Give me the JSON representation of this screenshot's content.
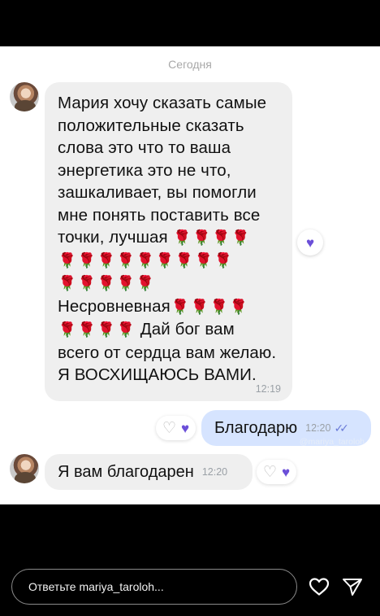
{
  "chat": {
    "date_separator": "Сегодня",
    "messages": [
      {
        "direction": "incoming",
        "text_lines": [
          "Мария хочу сказать самые",
          "положительные сказать",
          "слова это что то ваша",
          "энергетика это не что,",
          "зашкаливает, вы помогли",
          "мне понять поставить все",
          "точки, лучшая"
        ],
        "text_after_first_roses": "Несровневная",
        "text_after_second_roses": "Дай бог вам всего от сердца вам желаю. Я ВОСХИЩАЮСЬ ВАМИ.",
        "time": "12:19",
        "reaction": "purple-heart-icon"
      },
      {
        "direction": "outgoing",
        "text": "Благодарю",
        "time": "12:20",
        "status": "read-double-check",
        "watermark": "@mariya_taroloh"
      },
      {
        "direction": "incoming",
        "text": "Я вам благодарен",
        "time": "12:20"
      }
    ]
  },
  "story_footer": {
    "reply_placeholder": "Ответьте mariya_taroloh...",
    "like_icon": "heart-outline-icon",
    "share_icon": "send-paper-plane-icon"
  },
  "colors": {
    "incoming_bubble": "#efefef",
    "outgoing_bubble": "#d6e4ff",
    "reaction_heart": "#6b4fd8",
    "rose": "#c8102e"
  }
}
